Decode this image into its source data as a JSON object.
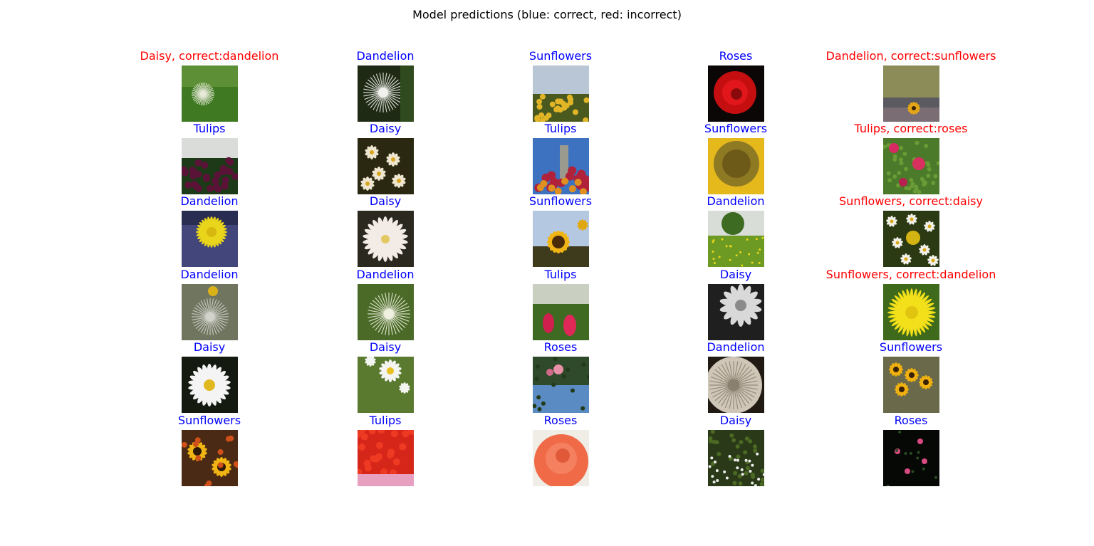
{
  "title": "Model predictions (blue: correct, red: incorrect)",
  "colors": {
    "correct": "#0000ff",
    "incorrect": "#ff0000",
    "background": "#ffffff",
    "title_text": "#000000"
  },
  "grid": {
    "rows": 6,
    "cols": 5,
    "cells": [
      {
        "label": "Daisy, correct:dandelion",
        "correct": false,
        "image": "dandelion-seedhead-green"
      },
      {
        "label": "Dandelion",
        "correct": true,
        "image": "dandelion-seedhead"
      },
      {
        "label": "Sunflowers",
        "correct": true,
        "image": "sunflower-field"
      },
      {
        "label": "Roses",
        "correct": true,
        "image": "red-rose"
      },
      {
        "label": "Dandelion, correct:sunflowers",
        "correct": false,
        "image": "sunflower-road"
      },
      {
        "label": "Tulips",
        "correct": true,
        "image": "purple-tulips"
      },
      {
        "label": "Daisy",
        "correct": true,
        "image": "white-daisies"
      },
      {
        "label": "Tulips",
        "correct": true,
        "image": "tulips-statue"
      },
      {
        "label": "Sunflowers",
        "correct": true,
        "image": "sunflower-closeup"
      },
      {
        "label": "Tulips, correct:roses",
        "correct": false,
        "image": "pink-roses-bush"
      },
      {
        "label": "Dandelion",
        "correct": true,
        "image": "yellow-dandelion-lavender"
      },
      {
        "label": "Daisy",
        "correct": true,
        "image": "white-daisy-closeup"
      },
      {
        "label": "Sunflowers",
        "correct": true,
        "image": "sunflower-sky"
      },
      {
        "label": "Dandelion",
        "correct": true,
        "image": "dandelion-meadow"
      },
      {
        "label": "Sunflowers, correct:daisy",
        "correct": false,
        "image": "daisy-cluster"
      },
      {
        "label": "Dandelion",
        "correct": true,
        "image": "dandelion-puff"
      },
      {
        "label": "Dandelion",
        "correct": true,
        "image": "dandelion-seeds-green"
      },
      {
        "label": "Tulips",
        "correct": true,
        "image": "red-tulips-hanging"
      },
      {
        "label": "Daisy",
        "correct": true,
        "image": "grayscale-daisy"
      },
      {
        "label": "Sunflowers, correct:dandelion",
        "correct": false,
        "image": "yellow-dandelion-bloom"
      },
      {
        "label": "Daisy",
        "correct": true,
        "image": "white-daisy-dark"
      },
      {
        "label": "Daisy",
        "correct": true,
        "image": "daisies-field"
      },
      {
        "label": "Roses",
        "correct": true,
        "image": "roses-palm"
      },
      {
        "label": "Dandelion",
        "correct": true,
        "image": "dandelion-seedhead-large"
      },
      {
        "label": "Sunflowers",
        "correct": true,
        "image": "sunflowers-group"
      },
      {
        "label": "Sunflowers",
        "correct": true,
        "image": "sunflower-bouquet"
      },
      {
        "label": "Tulips",
        "correct": true,
        "image": "red-tulips-field"
      },
      {
        "label": "Roses",
        "correct": true,
        "image": "orange-rose"
      },
      {
        "label": "Daisy",
        "correct": true,
        "image": "small-white-flowers"
      },
      {
        "label": "Roses",
        "correct": true,
        "image": "pink-roses-dark"
      }
    ]
  }
}
